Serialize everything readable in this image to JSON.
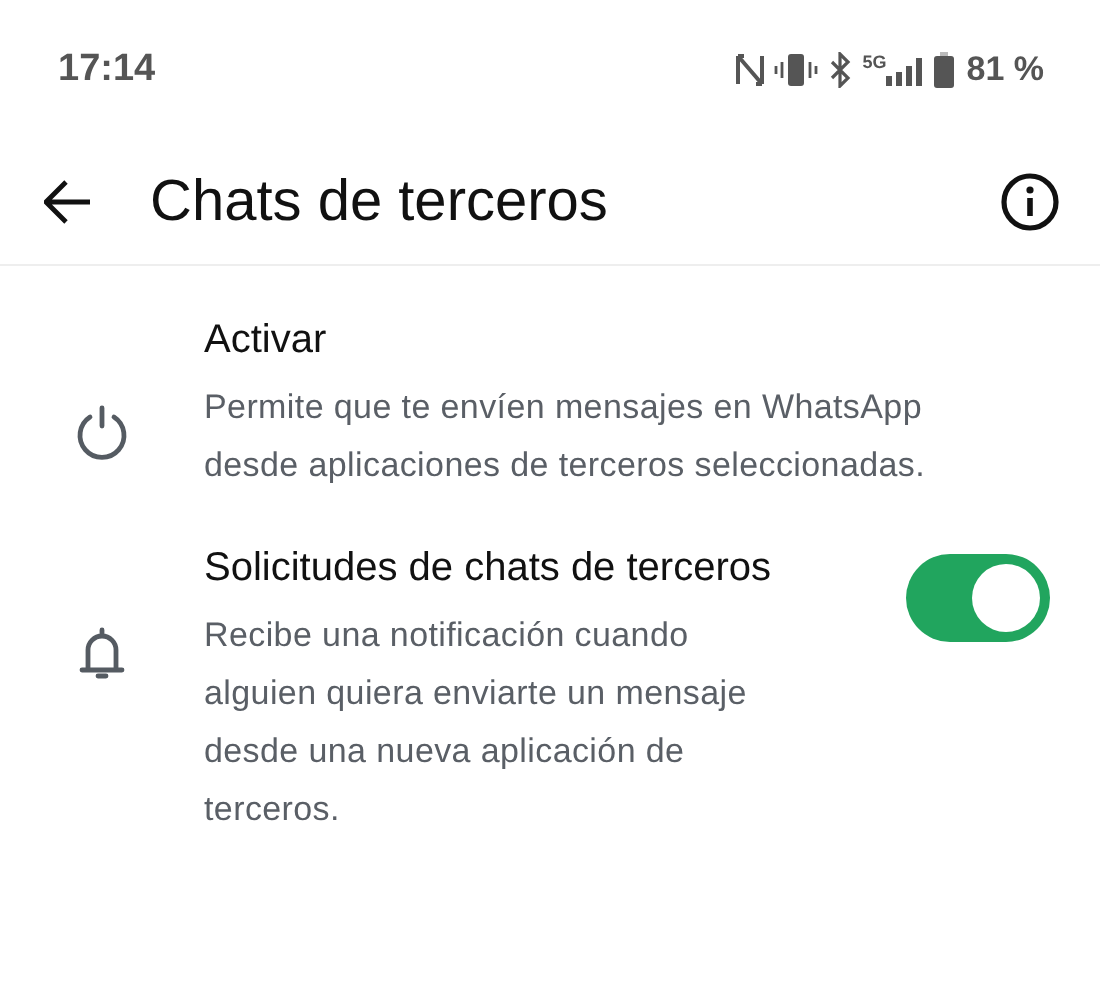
{
  "status_bar": {
    "time": "17:14",
    "network": "5G",
    "battery": "81 %"
  },
  "header": {
    "title": "Chats de terceros"
  },
  "settings": [
    {
      "kind": "action",
      "title": "Activar",
      "description": "Permite que te envíen mensajes en WhatsApp desde aplicaciones de terceros seleccionadas."
    },
    {
      "kind": "toggle",
      "title": "Solicitudes de chats de terceros",
      "description": "Recibe una notificación cuando alguien quiera enviarte un mensaje desde una nueva aplicación de terceros.",
      "on": true
    }
  ]
}
